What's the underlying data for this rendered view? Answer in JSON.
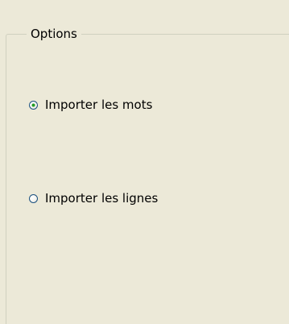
{
  "group": {
    "title": "Options"
  },
  "options": [
    {
      "label": "Importer les mots",
      "checked": true
    },
    {
      "label": "Importer les lignes",
      "checked": false
    }
  ]
}
